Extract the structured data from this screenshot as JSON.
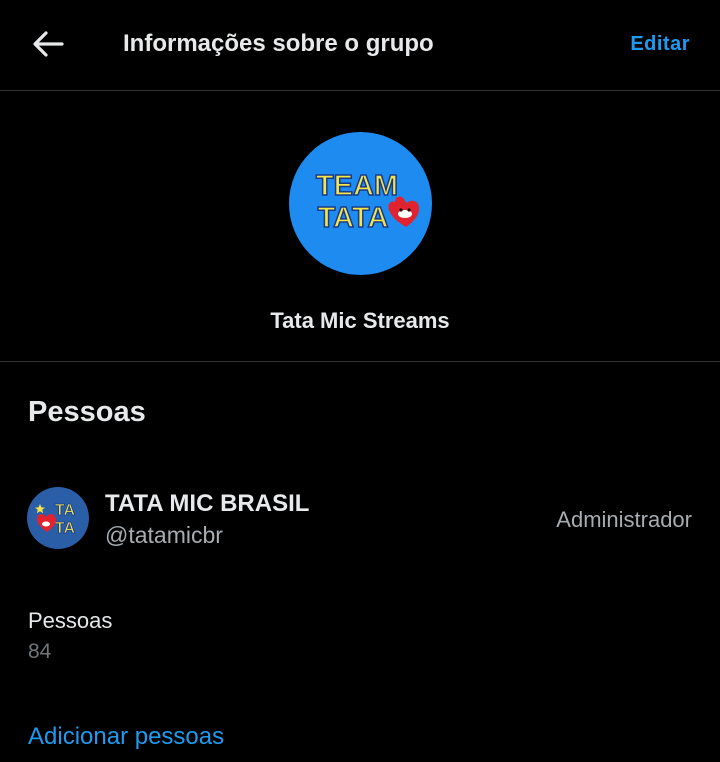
{
  "header": {
    "title": "Informações sobre o grupo",
    "edit_label": "Editar",
    "back_icon": "arrow-left-icon"
  },
  "group": {
    "name": "Tata Mic Streams",
    "avatar_text_line1": "TEAM",
    "avatar_text_line2": "TATA"
  },
  "people_section": {
    "title": "Pessoas",
    "members": [
      {
        "name": "TATA MIC BRASIL",
        "handle": "@tatamicbr",
        "role": "Administrador",
        "avatar_text_line1": "TA",
        "avatar_text_line2": "TA"
      }
    ],
    "count_label": "Pessoas",
    "count_value": "84",
    "add_label": "Adicionar pessoas"
  },
  "colors": {
    "background": "#000000",
    "accent": "#1d9bf0",
    "text_primary": "#e7e9ea",
    "text_secondary": "#71767b",
    "divider": "#2f3336",
    "avatar_blue": "#1d8bf0",
    "logo_yellow": "#f5e64a",
    "logo_red": "#e0232e"
  }
}
